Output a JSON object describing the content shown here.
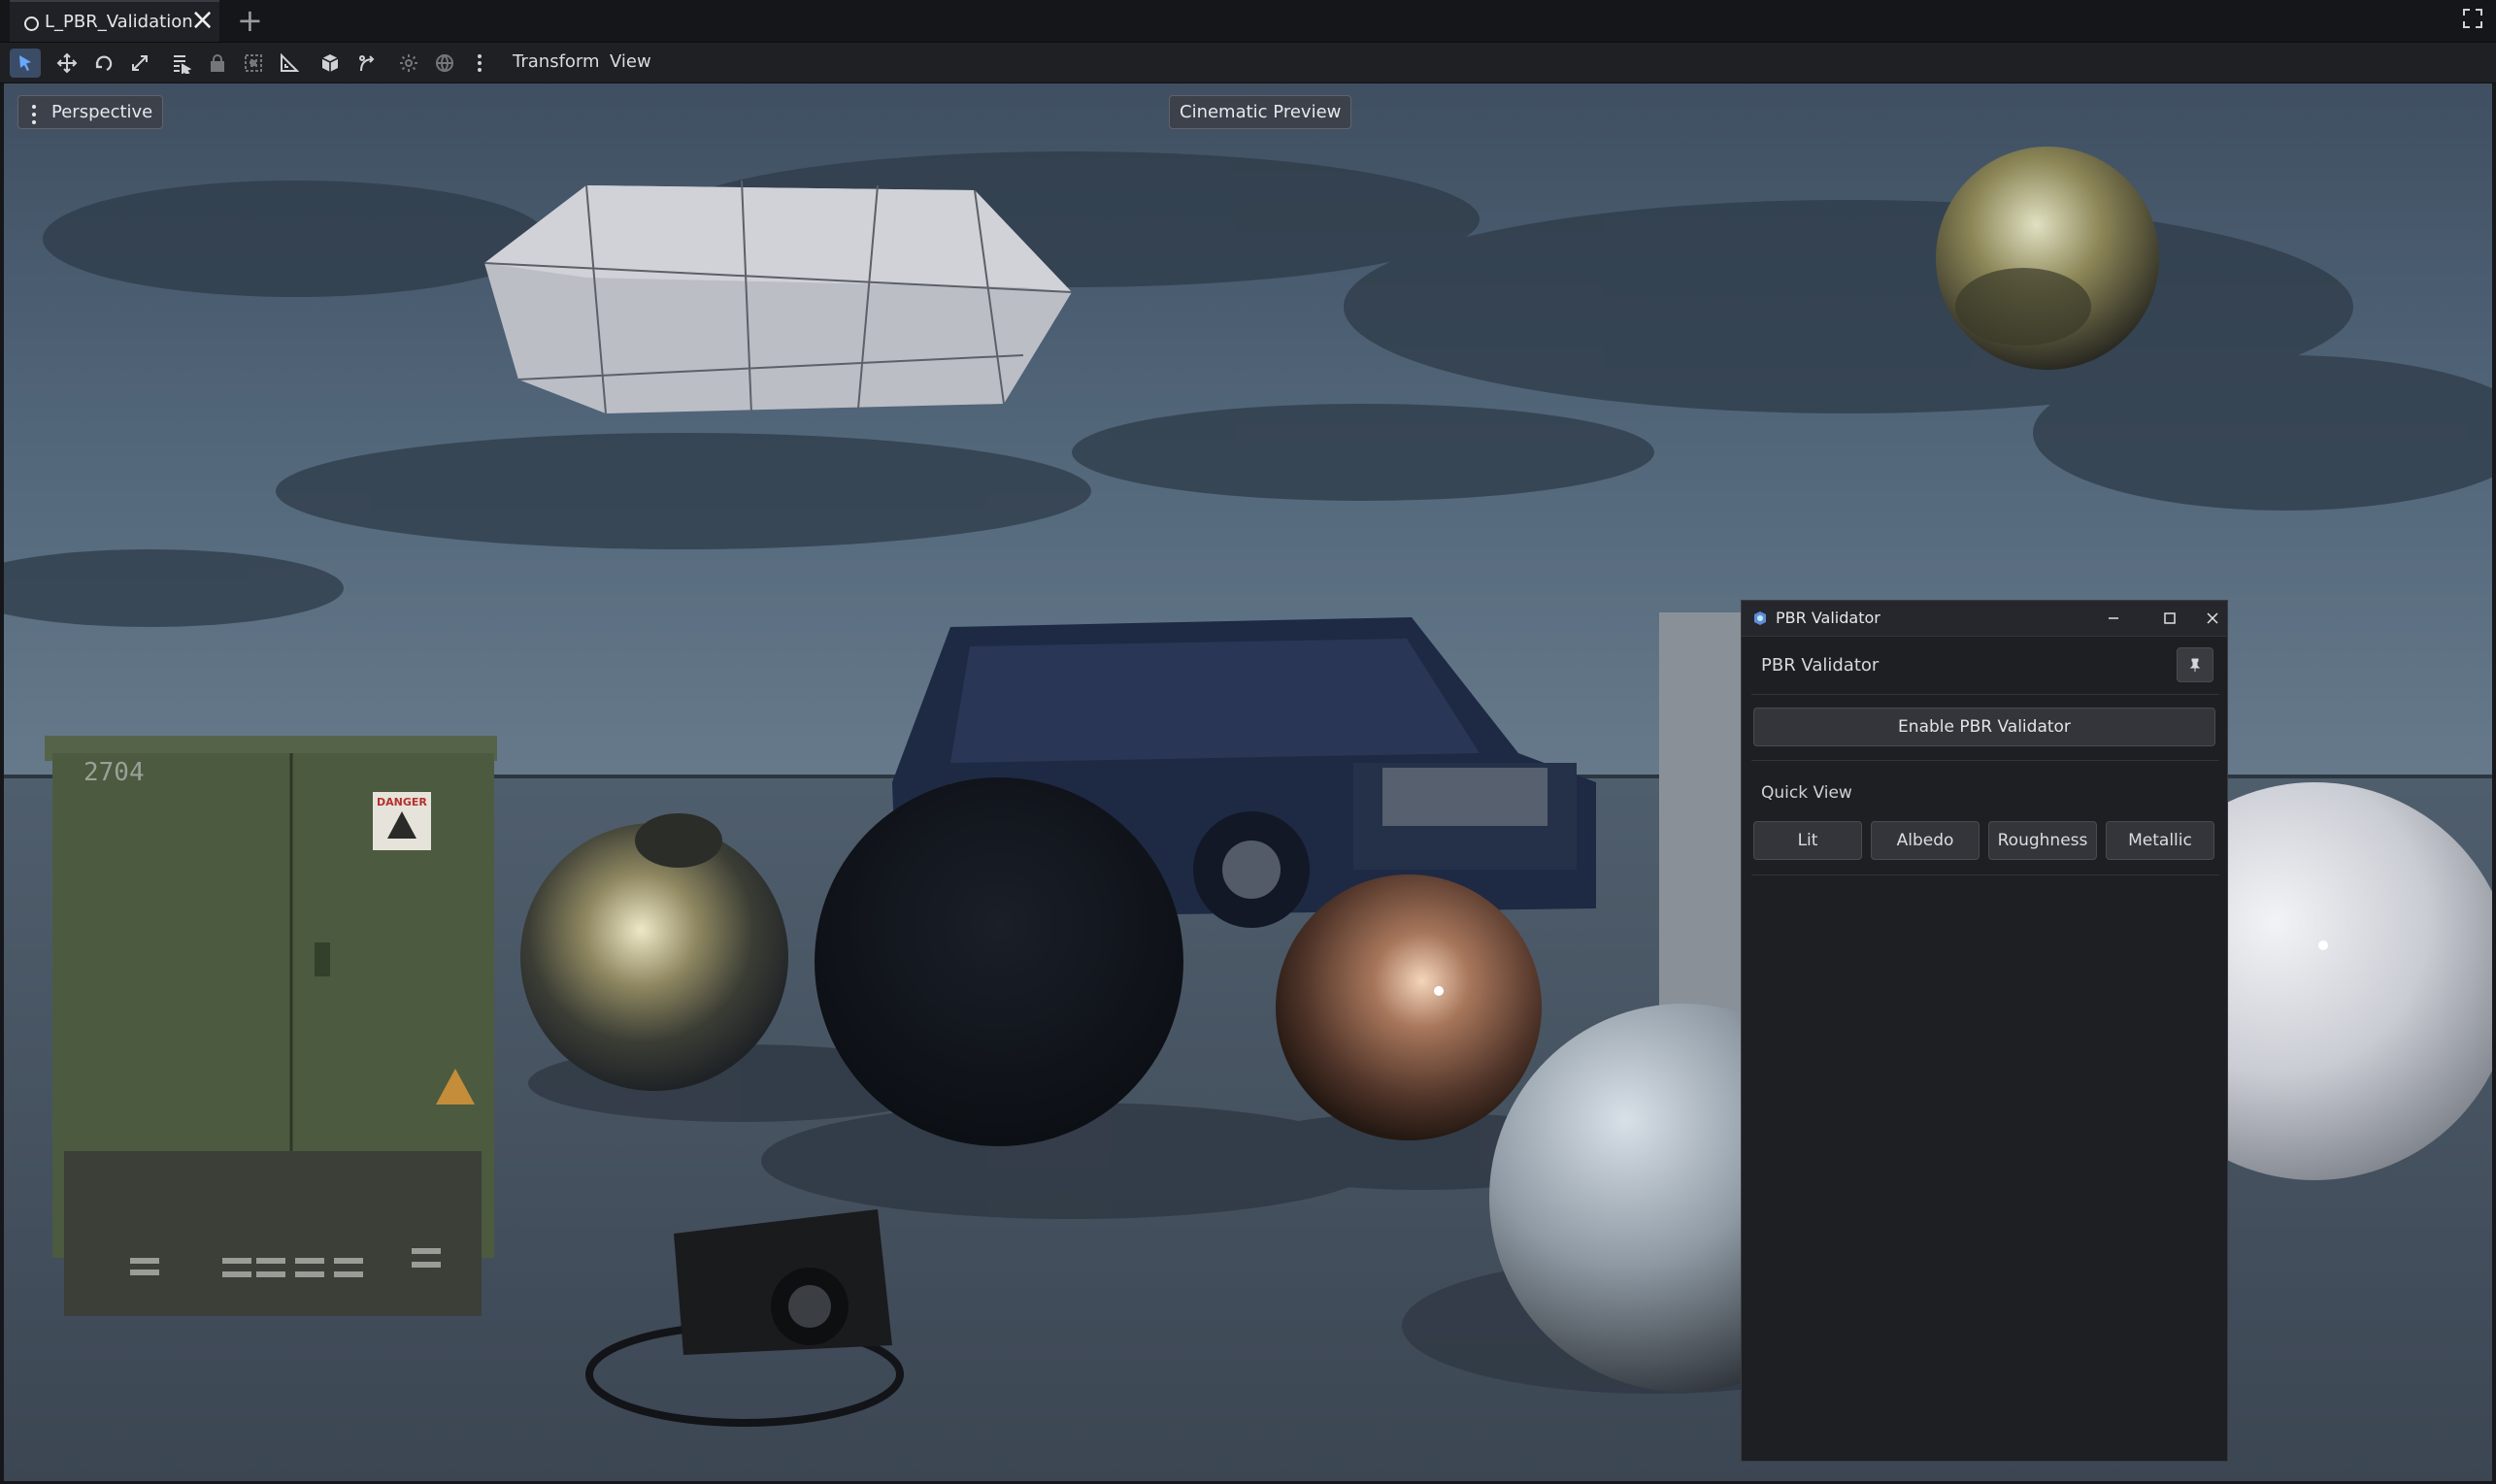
{
  "tab": {
    "title": "L_PBR_Validation",
    "close_glyph": "×",
    "add_glyph": "+"
  },
  "toolbar": {
    "icons": [
      "select-icon",
      "move-icon",
      "rotate-icon",
      "scale-icon",
      "list-select-icon",
      "lock-icon",
      "group-icon",
      "ruler-icon",
      "cube-icon",
      "snap-icon",
      "sun-icon",
      "globe-icon",
      "more-icon"
    ],
    "menus": {
      "transform": "Transform",
      "view": "View"
    }
  },
  "viewport": {
    "perspective_label": "Perspective",
    "camera_label": "Cinematic Preview",
    "cabinet_number": "2704",
    "danger_text": "DANGER"
  },
  "panel": {
    "window_title": "PBR Validator",
    "header": "PBR Validator",
    "enable_button": "Enable PBR Validator",
    "quick_view_label": "Quick View",
    "quick_view_buttons": [
      "Lit",
      "Albedo",
      "Roughness",
      "Metallic"
    ]
  },
  "colors": {
    "accent": "#3a4c66",
    "panel_bg": "#1e1f23",
    "tabbar_bg": "#151619"
  }
}
